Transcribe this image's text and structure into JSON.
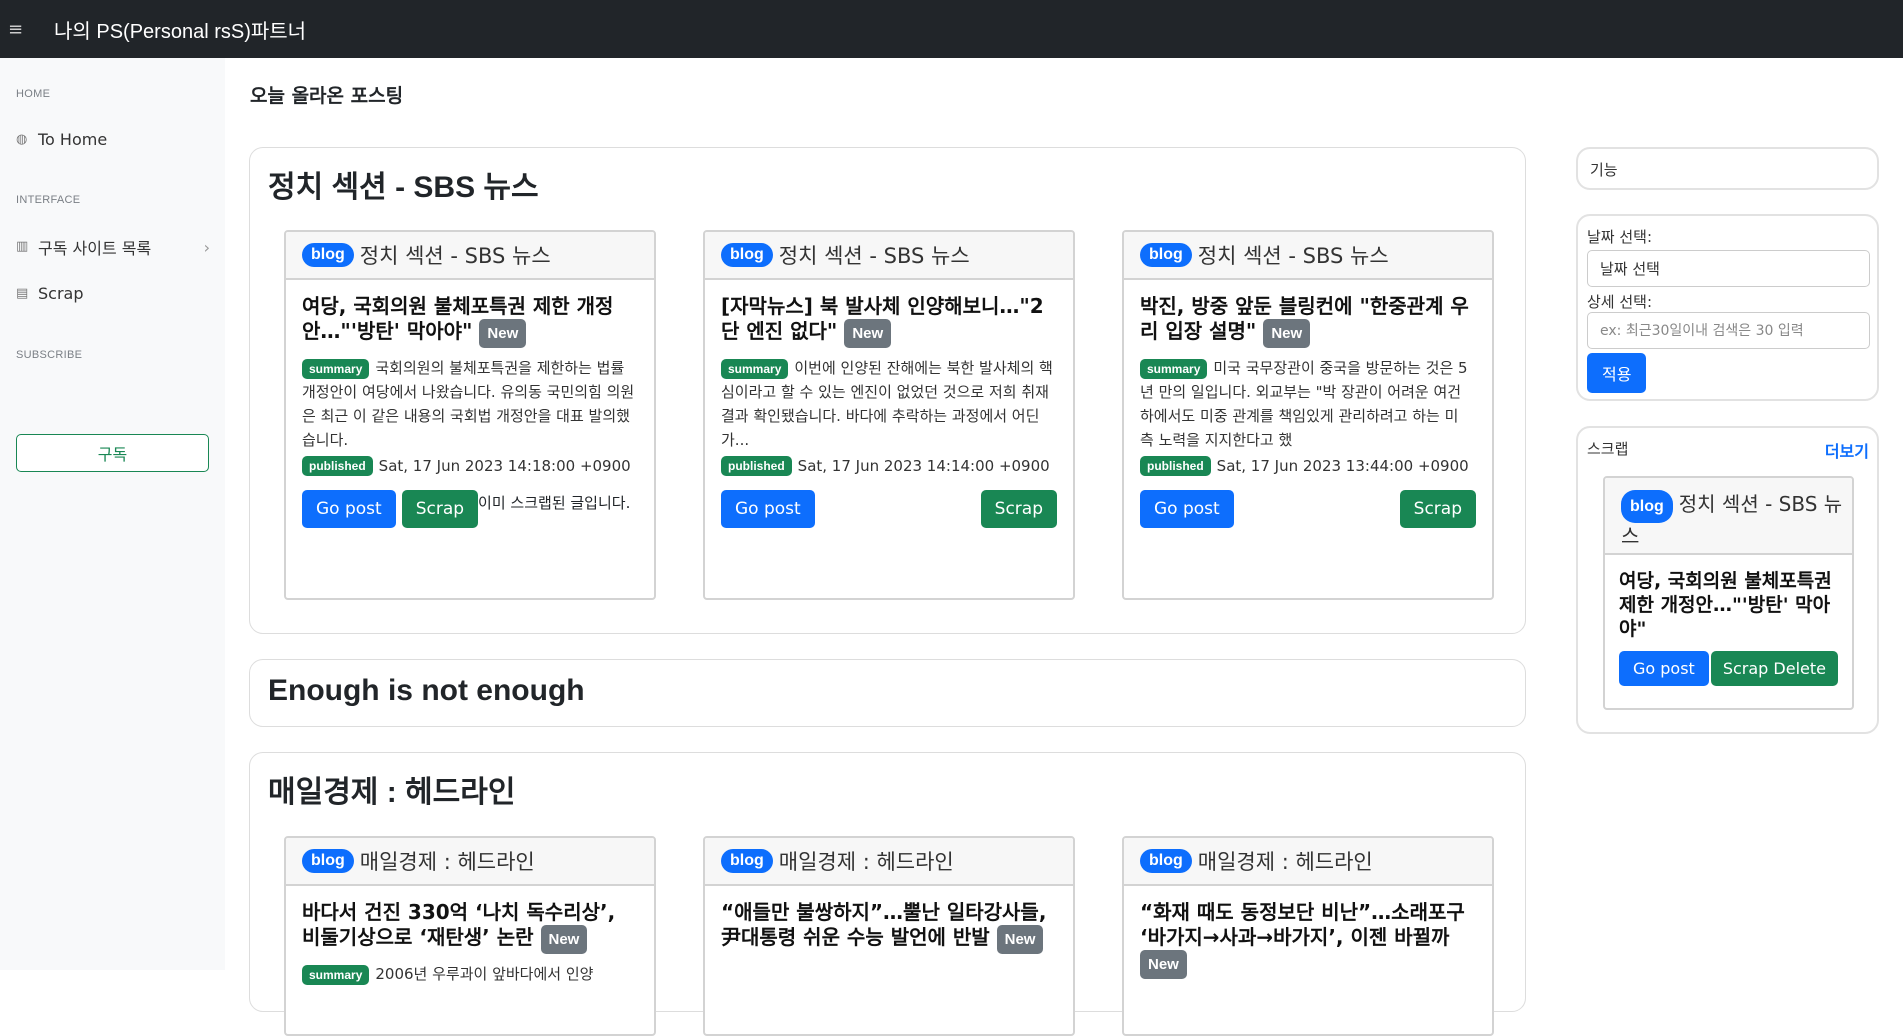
{
  "app": {
    "title": "나의 PS(Personal rsS)파트너",
    "menu_icon": "≡"
  },
  "sidebar": {
    "home_header": "HOME",
    "home_item": "To Home",
    "interface_header": "INTERFACE",
    "sub_list_item": "구독 사이트 목록",
    "scrap_item": "Scrap",
    "subscribe_header": "SUBSCRIBE",
    "subscribe_button": "구독"
  },
  "main": {
    "title": "오늘 올라온 포스팅"
  },
  "sections": [
    {
      "title": "정치 섹션 - SBS 뉴스",
      "cards": [
        {
          "badge": "blog",
          "source": "정치 섹션 - SBS 뉴스",
          "title": "여당, 국회의원 불체포특권 제한 개정안…\"'방탄' 막아야\"",
          "new": "New",
          "summary_label": "summary",
          "summary": "국회의원의 불체포특권을 제한하는 법률 개정안이 여당에서 나왔습니다. 유의동 국민의힘 의원은 최근 이 같은 내용의 국회법 개정안을 대표 발의했습니다.",
          "published_label": "published",
          "published": "Sat, 17 Jun 2023 14:18:00 +0900",
          "go": "Go post",
          "scrap": "Scrap",
          "note": "이미 스크랩된 글입니다."
        },
        {
          "badge": "blog",
          "source": "정치 섹션 - SBS 뉴스",
          "title": "[자막뉴스] 북 발사체 인양해보니…\"2단 엔진 없다\"",
          "new": "New",
          "summary_label": "summary",
          "summary": "이번에 인양된 잔해에는 북한 발사체의 핵심이라고 할 수 있는 엔진이 없었던 것으로 저희 취재 결과 확인됐습니다. 바다에 추락하는 과정에서 어딘가...",
          "published_label": "published",
          "published": "Sat, 17 Jun 2023 14:14:00 +0900",
          "go": "Go post",
          "scrap": "Scrap"
        },
        {
          "badge": "blog",
          "source": "정치 섹션 - SBS 뉴스",
          "title": "박진, 방중 앞둔 블링컨에 \"한중관계 우리 입장 설명\"",
          "new": "New",
          "summary_label": "summary",
          "summary": "미국 국무장관이 중국을 방문하는 것은 5년 만의 일입니다. 외교부는 \"박 장관이 어려운 여건 하에서도 미중 관계를 책임있게 관리하려고 하는 미 측 노력을 지지한다고 했",
          "published_label": "published",
          "published": "Sat, 17 Jun 2023 13:44:00 +0900",
          "go": "Go post",
          "scrap": "Scrap"
        }
      ]
    },
    {
      "title": "Enough is not enough"
    },
    {
      "title": "매일경제 : 헤드라인",
      "cards": [
        {
          "badge": "blog",
          "source": "매일경제 : 헤드라인",
          "title": "바다서 건진 330억 ‘나치 독수리상’, 비둘기상으로 ‘재탄생’ 논란",
          "new": "New",
          "summary_label": "summary",
          "summary": "2006년 우루과이 앞바다에서 인양"
        },
        {
          "badge": "blog",
          "source": "매일경제 : 헤드라인",
          "title": "“애들만 불쌍하지”…뿔난 일타강사들, 尹대통령 쉬운 수능 발언에 반발",
          "new": "New"
        },
        {
          "badge": "blog",
          "source": "매일경제 : 헤드라인",
          "title": "“화재 때도 동정보단 비난”…소래포구 ‘바가지→사과→바가지’, 이젠 바뀔까",
          "new": "New"
        }
      ]
    }
  ],
  "right": {
    "func_label": "기능",
    "date_label": "날짜 선택:",
    "date_value": "날짜 선택",
    "detail_label": "상세 선택:",
    "detail_placeholder": "ex: 최근30일이내 검색은 30 입력",
    "apply": "적용",
    "scrap_title": "스크랩",
    "more": "더보기",
    "scrap_card": {
      "badge": "blog",
      "source": "정치 섹션 - SBS 뉴스",
      "title": "여당, 국회의원 불체포특권 제한 개정안…\"'방탄' 막아야\"",
      "go": "Go post",
      "delete": "Scrap Delete"
    }
  },
  "colors": {
    "primary": "#0d6efd",
    "success": "#198754",
    "dark": "#212529",
    "secondary": "#6c757d"
  }
}
